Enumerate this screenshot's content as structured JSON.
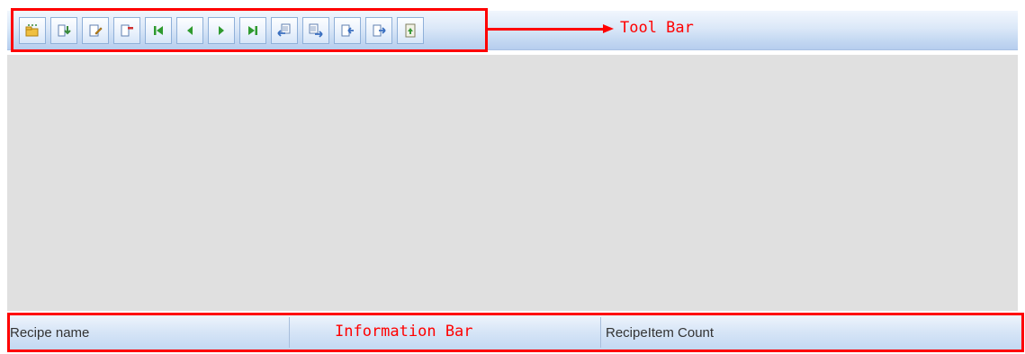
{
  "toolbar": {
    "buttons": [
      {
        "name": "new-recipe",
        "icon": "new-folder-icon",
        "color": "#e0b020"
      },
      {
        "name": "insert-item",
        "icon": "insert-item-icon",
        "color": "#3a8a3a"
      },
      {
        "name": "edit-item",
        "icon": "edit-item-icon",
        "color": "#e0a020"
      },
      {
        "name": "delete-item",
        "icon": "delete-item-icon",
        "color": "#d03030"
      },
      {
        "name": "first",
        "icon": "skip-first-icon",
        "color": "#2e9a2e"
      },
      {
        "name": "previous",
        "icon": "previous-icon",
        "color": "#2e9a2e"
      },
      {
        "name": "next",
        "icon": "next-icon",
        "color": "#2e9a2e"
      },
      {
        "name": "last",
        "icon": "skip-last-icon",
        "color": "#2e9a2e"
      },
      {
        "name": "download",
        "icon": "download-icon",
        "color": "#3a6fc0"
      },
      {
        "name": "upload",
        "icon": "upload-icon",
        "color": "#3a6fc0"
      },
      {
        "name": "import",
        "icon": "import-icon",
        "color": "#3a6fc0"
      },
      {
        "name": "export",
        "icon": "export-icon",
        "color": "#3a6fc0"
      },
      {
        "name": "save",
        "icon": "save-icon",
        "color": "#3a9a3a"
      }
    ]
  },
  "annotations": {
    "toolbar_label": "Tool Bar",
    "infobar_label": "Information Bar",
    "highlight_color": "#ff0000"
  },
  "infobar": {
    "recipe_name_label": "Recipe name",
    "recipe_item_count_label": "RecipeItem Count"
  }
}
